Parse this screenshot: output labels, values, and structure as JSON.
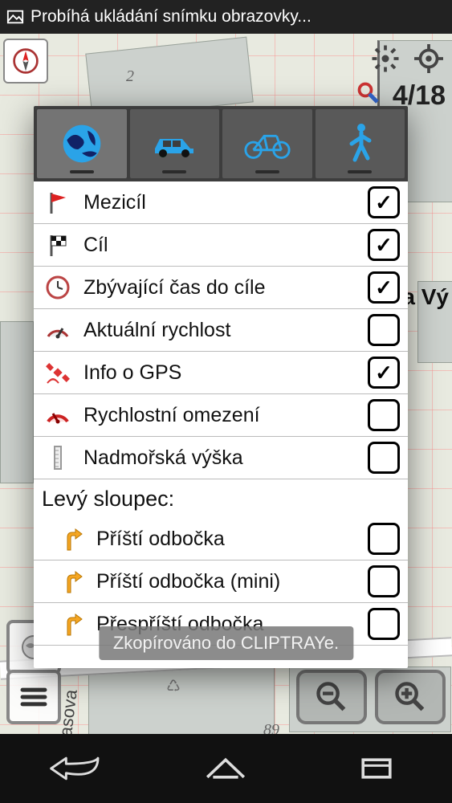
{
  "status_bar": {
    "title": "Probíhá ukládání snímku obrazovky..."
  },
  "map": {
    "counter": "4/18",
    "label_right": "a Vý",
    "num2": "2",
    "num89": "89",
    "street": "asova"
  },
  "dialog": {
    "tabs": [
      {
        "name": "browse",
        "active": true
      },
      {
        "name": "car",
        "active": false
      },
      {
        "name": "bike",
        "active": false
      },
      {
        "name": "walk",
        "active": false
      }
    ],
    "items": [
      {
        "icon": "flag-red",
        "label": "Mezicíl",
        "checked": true
      },
      {
        "icon": "flag-checker",
        "label": "Cíl",
        "checked": true
      },
      {
        "icon": "clock",
        "label": "Zbývající čas do cíle",
        "checked": true
      },
      {
        "icon": "gauge-simple",
        "label": "Aktuální rychlost",
        "checked": false
      },
      {
        "icon": "satellite",
        "label": "Info o GPS",
        "checked": true
      },
      {
        "icon": "gauge-red",
        "label": "Rychlostní omezení",
        "checked": false
      },
      {
        "icon": "ruler",
        "label": "Nadmořská výška",
        "checked": false
      }
    ],
    "section_header": "Levý sloupec:",
    "items2": [
      {
        "icon": "turn-arrow",
        "label": "Příští odbočka",
        "checked": false
      },
      {
        "icon": "turn-arrow",
        "label": "Příští odbočka (mini)",
        "checked": false
      },
      {
        "icon": "turn-arrow",
        "label": "Přespříští odbočka",
        "checked": false
      }
    ]
  },
  "toast": {
    "text": "Zkopírováno do CLIPTRAYe."
  }
}
